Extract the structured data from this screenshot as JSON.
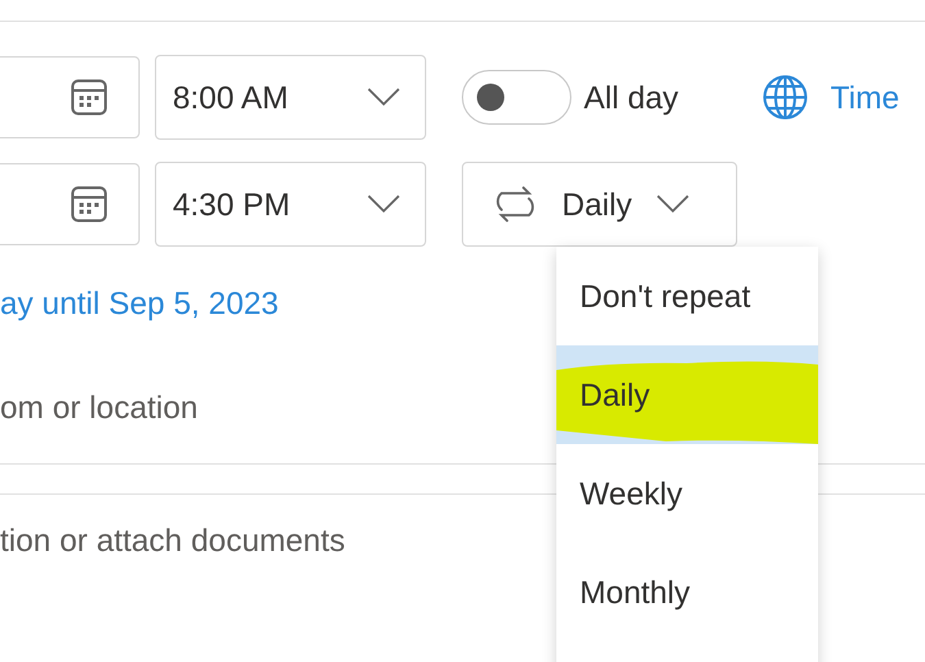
{
  "start": {
    "time": "8:00 AM"
  },
  "all_day": {
    "label": "All day",
    "on": false
  },
  "time_zone": {
    "label": "Time"
  },
  "end": {
    "time": "4:30 PM"
  },
  "repeat": {
    "value": "Daily"
  },
  "recurrence_summary": "ay until Sep 5, 2023",
  "location": {
    "placeholder": "om or location"
  },
  "body": {
    "placeholder": "tion or attach documents"
  },
  "repeat_menu": {
    "items": [
      {
        "label": "Don't repeat",
        "selected": false
      },
      {
        "label": "Daily",
        "selected": true
      },
      {
        "label": "Weekly",
        "selected": false
      },
      {
        "label": "Monthly",
        "selected": false
      }
    ]
  }
}
